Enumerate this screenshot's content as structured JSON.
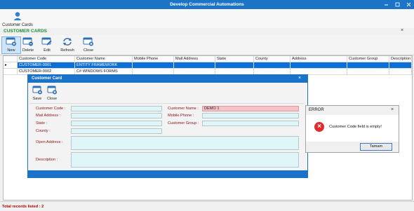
{
  "window": {
    "title": "Develop Commercial Automations"
  },
  "ribbon": {
    "item_label": "Customer Cards",
    "item_icon": "user-icon"
  },
  "panel": {
    "title": "CUSTOMER CARDS",
    "close": "×"
  },
  "toolbar": [
    {
      "label": "New",
      "icon": "new-icon"
    },
    {
      "label": "Delete",
      "icon": "delete-icon"
    },
    {
      "label": "Edit",
      "icon": "edit-icon"
    },
    {
      "label": "Refresh",
      "icon": "refresh-icon"
    },
    {
      "label": "Close",
      "icon": "close-icon"
    }
  ],
  "grid": {
    "columns": [
      "Customer Code",
      "Customer Name",
      "Mobile Phone",
      "Mail Address",
      "State",
      "County",
      "Address",
      "Customer Group",
      "Description"
    ],
    "rows": [
      {
        "marker": "▸",
        "cells": [
          "CUSTOMER-0001",
          "ENTITY FRAMEWORK",
          "",
          "",
          "",
          "",
          "",
          "",
          ""
        ]
      },
      {
        "marker": "",
        "cells": [
          "CUSTOMER-0002",
          "C# WINDOWS FORMS",
          "",
          "",
          "",
          "",
          "",
          "",
          ""
        ]
      }
    ]
  },
  "card_dialog": {
    "title": "Customer Card",
    "close": "×",
    "save_label": "Save",
    "close_label": "Close",
    "fields": {
      "customer_code": {
        "label": "Customer Code :",
        "value": ""
      },
      "mail_address": {
        "label": "Mail Address :",
        "value": ""
      },
      "state": {
        "label": "State :",
        "value": ""
      },
      "county": {
        "label": "County :",
        "value": ""
      },
      "customer_name": {
        "label": "Customer Name :",
        "value": "DEMO 1"
      },
      "mobile_phone": {
        "label": "Mobile Phone :",
        "value": ""
      },
      "customer_group": {
        "label": "Customer Group :",
        "value": ""
      },
      "open_address": {
        "label": "Open Address :",
        "value": ""
      },
      "description": {
        "label": "Description :",
        "value": ""
      }
    }
  },
  "error_dialog": {
    "title": "ERROR",
    "close": "×",
    "message": "Customer Code field is empty!",
    "ok_label": "Tamam",
    "icon": "error-icon"
  },
  "status": {
    "text": "Total records listed : 2"
  },
  "colors": {
    "accent": "#1c74c7",
    "panel_title": "#218c35",
    "selection": "#0a6fd6",
    "error_field": "#f7c2c8",
    "input_field": "#dff5f8"
  }
}
